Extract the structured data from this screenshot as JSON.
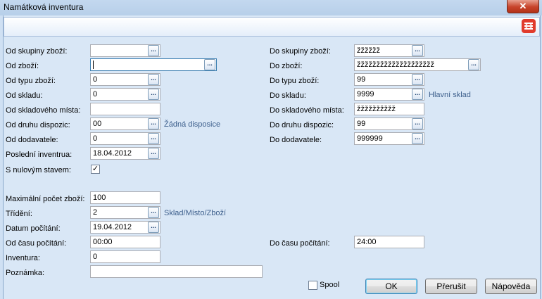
{
  "window": {
    "title": "Namátková inventura",
    "close": "✕"
  },
  "left": {
    "skupiny_label": "Od skupiny zboží:",
    "skupiny_value": "",
    "zbozi_label": "Od zboží:",
    "zbozi_value": "",
    "typu_label": "Od typu zboží:",
    "typu_value": "0",
    "skladu_label": "Od skladu:",
    "skladu_value": "0",
    "mista_label": "Od skladového místa:",
    "mista_value": "",
    "dispozic_label": "Od druhu dispozic:",
    "dispozic_value": "00",
    "dispozic_hint": "Žádná disposice",
    "dodavatele_label": "Od dodavatele:",
    "dodavatele_value": "0",
    "inventura_label": "Poslední inventrua:",
    "inventura_value": "18.04.2012",
    "nulovy_label": "S nulovým stavem:",
    "nulovy_checked": "✓"
  },
  "right": {
    "skupiny_label": "Do skupiny zboží:",
    "skupiny_value": "žžžžžž",
    "zbozi_label": "Do zboží:",
    "zbozi_value": "žžžžžžžžžžžžžžžžžžžž",
    "typu_label": "Do typu zboží:",
    "typu_value": "99",
    "skladu_label": "Do skladu:",
    "skladu_value": "9999",
    "skladu_hint": "Hlavní sklad",
    "mista_label": "Do skladového místa:",
    "mista_value": "žžžžžžžžžž",
    "dispozic_label": "Do druhu dispozic:",
    "dispozic_value": "99",
    "dodavatele_label": "Do dodavatele:",
    "dodavatele_value": "999999",
    "cas_label": "Do času počítání:",
    "cas_value": "24:00"
  },
  "bottom": {
    "max_label": "Maximální počet zboží:",
    "max_value": "100",
    "trideni_label": "Třídění:",
    "trideni_value": "2",
    "trideni_hint": "Sklad/Místo/Zboží",
    "datum_label": "Datum počítání:",
    "datum_value": "19.04.2012",
    "odcas_label": "Od času počítání:",
    "odcas_value": "00:00",
    "inv_label": "Inventura:",
    "inv_value": "0",
    "poznamka_label": "Poznámka:",
    "poznamka_value": ""
  },
  "buttons": {
    "ellipsis": "...",
    "spool": "Spool",
    "ok": "OK",
    "cancel": "Přerušit",
    "help": "Nápověda"
  },
  "colors": {
    "background": "#d9e7f6",
    "hint_text": "#3d5f8c",
    "close_button": "#c7432a"
  }
}
